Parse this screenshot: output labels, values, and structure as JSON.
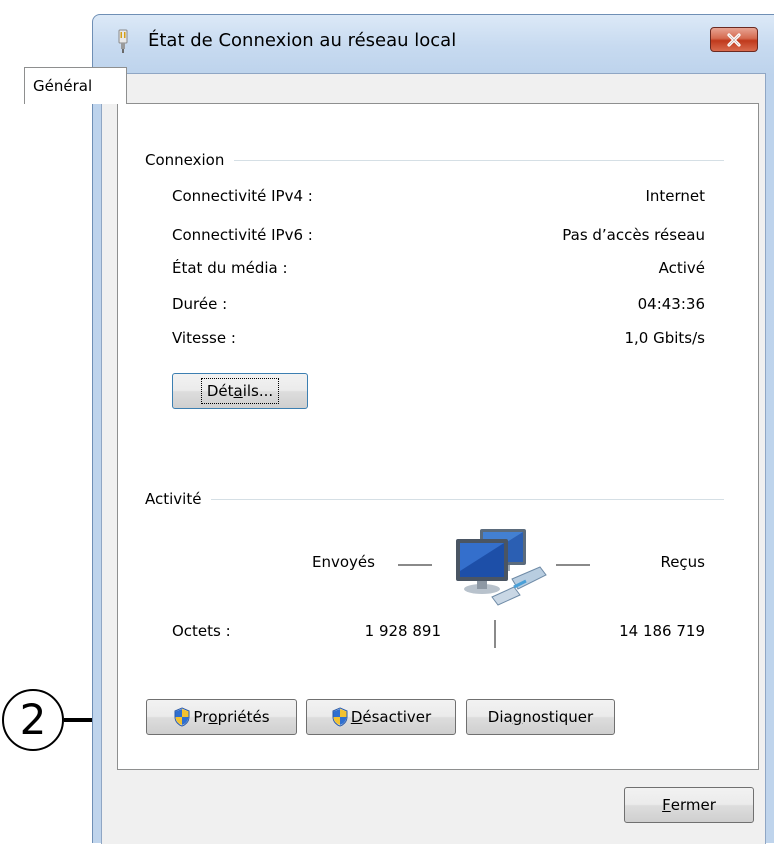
{
  "callout": {
    "number": "2"
  },
  "window": {
    "title": "État de Connexion au réseau local",
    "close_icon": "close-x-icon"
  },
  "tabs": [
    {
      "label": "Général",
      "selected": true
    }
  ],
  "connexion": {
    "heading": "Connexion",
    "rows": [
      {
        "label": "Connectivité IPv4 :",
        "value": "Internet"
      },
      {
        "label": "Connectivité IPv6 :",
        "value": "Pas d’accès réseau"
      },
      {
        "label": "État du média :",
        "value": "Activé"
      },
      {
        "label": "Durée :",
        "value": "04:43:36"
      },
      {
        "label": "Vitesse :",
        "value": "1,0 Gbits/s"
      }
    ],
    "details_button": {
      "pre": "Dét",
      "key": "a",
      "post": "ils..."
    }
  },
  "activite": {
    "heading": "Activité",
    "sent_label": "Envoyés",
    "received_label": "Reçus",
    "bytes_label": "Octets :",
    "bytes_sent": "1 928 891",
    "bytes_received": "14 186 719",
    "icon": "network-computers-icon"
  },
  "buttons": {
    "properties": {
      "pre": "Pr",
      "key": "o",
      "post": "priétés",
      "icon": "uac-shield-icon"
    },
    "disable": {
      "pre": "",
      "key": "D",
      "post": "ésactiver",
      "icon": "uac-shield-icon"
    },
    "diagnose": {
      "pre": "Dia",
      "key": "g",
      "post": "nostiquer"
    },
    "close": {
      "pre": "",
      "key": "F",
      "post": "ermer"
    }
  },
  "colors": {
    "title_gradient_top": "#dce9f7",
    "close_button_red": "#c0391c",
    "panel_background": "#ffffff"
  }
}
